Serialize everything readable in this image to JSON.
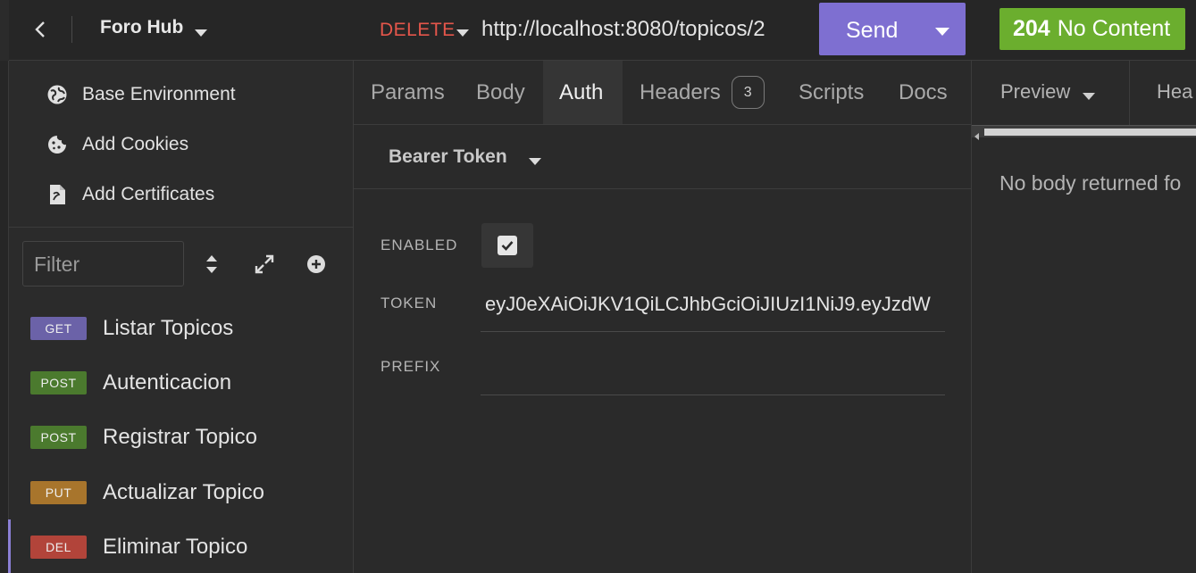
{
  "sidebar": {
    "workspace_title": "Foro Hub",
    "environment_items": [
      {
        "label": "Base Environment",
        "icon": "globe-icon"
      },
      {
        "label": "Add Cookies",
        "icon": "cookie-icon"
      },
      {
        "label": "Add Certificates",
        "icon": "certificate-icon"
      }
    ],
    "filter_placeholder": "Filter",
    "requests": [
      {
        "method": "GET",
        "name": "Listar Topicos"
      },
      {
        "method": "POST",
        "name": "Autenticacion"
      },
      {
        "method": "POST",
        "name": "Registrar Topico"
      },
      {
        "method": "PUT",
        "name": "Actualizar Topico"
      },
      {
        "method": "DEL",
        "name": "Eliminar Topico",
        "active": true
      }
    ]
  },
  "request": {
    "method": "DELETE",
    "url": "http://localhost:8080/topicos/2",
    "send_label": "Send",
    "tabs": [
      {
        "label": "Params"
      },
      {
        "label": "Body"
      },
      {
        "label": "Auth",
        "active": true
      },
      {
        "label": "Headers",
        "count": "3"
      },
      {
        "label": "Scripts"
      },
      {
        "label": "Docs"
      }
    ],
    "auth": {
      "type": "Bearer Token",
      "enabled_label": "ENABLED",
      "enabled": true,
      "token_label": "TOKEN",
      "token_value": "eyJ0eXAiOiJKV1QiLCJhbGciOiJIUzI1NiJ9.eyJzdW",
      "prefix_label": "PREFIX",
      "prefix_value": ""
    }
  },
  "response": {
    "status_code": "204",
    "status_text": "No Content",
    "tabs": [
      {
        "label": "Preview"
      },
      {
        "label": "Hea"
      }
    ],
    "empty_message": "No body returned fo"
  },
  "colors": {
    "accent": "#7e6fd1",
    "delete": "#e5564b",
    "success": "#6bae2e"
  }
}
